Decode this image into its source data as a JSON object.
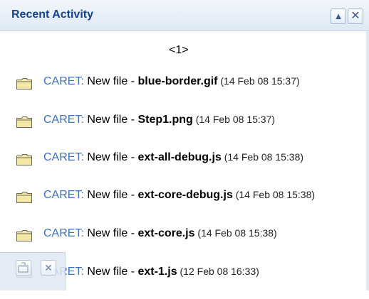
{
  "panel": {
    "title": "Recent Activity",
    "collapse_icon": "collapse-up-icon",
    "close_icon": "close-icon",
    "collapse_symbol": "▲",
    "close_symbol": "✕"
  },
  "pager": {
    "prev": "<",
    "page": "1",
    "next": ">"
  },
  "activity": {
    "items": [
      {
        "creator": "CARET:",
        "action": " New file - ",
        "file": "blue-border.gif",
        "time": " (14 Feb 08 15:37)"
      },
      {
        "creator": "CARET:",
        "action": " New file - ",
        "file": "Step1.png",
        "time": " (14 Feb 08 15:37)"
      },
      {
        "creator": "CARET:",
        "action": " New file - ",
        "file": "ext-all-debug.js",
        "time": " (14 Feb 08 15:38)"
      },
      {
        "creator": "CARET:",
        "action": " New file - ",
        "file": "ext-core-debug.js",
        "time": " (14 Feb 08 15:38)"
      },
      {
        "creator": "CARET:",
        "action": " New file - ",
        "file": "ext-core.js",
        "time": " (14 Feb 08 15:38)"
      },
      {
        "creator": "CARET:",
        "action": " New file - ",
        "file": "ext-1.js",
        "time": " (12 Feb 08 16:33)"
      }
    ]
  },
  "dock": {
    "restore_icon": "restore-window-icon",
    "close_icon": "close-icon",
    "close_symbol": "✕"
  },
  "colors": {
    "title": "#15428b",
    "creator_link": "#3d6fb6",
    "header_bg": "#dfe8f3",
    "folder": "#f3e7a8"
  }
}
